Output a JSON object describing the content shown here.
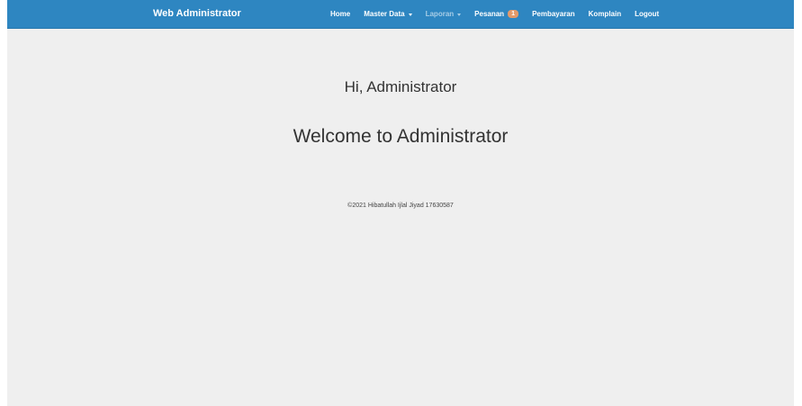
{
  "navbar": {
    "brand": "Web Administrator",
    "items": [
      {
        "label": "Home"
      },
      {
        "label": "Master Data"
      },
      {
        "label": "Laporan"
      },
      {
        "label": "Pesanan",
        "badge": "1"
      },
      {
        "label": "Pembayaran"
      },
      {
        "label": "Komplain"
      },
      {
        "label": "Logout"
      }
    ],
    "color": "#2e86c1"
  },
  "main": {
    "greeting": "Hi, Administrator",
    "welcome": "Welcome to Administrator",
    "footer": "©2021 Hibatullah Ijlal Jiyad 17630587"
  }
}
